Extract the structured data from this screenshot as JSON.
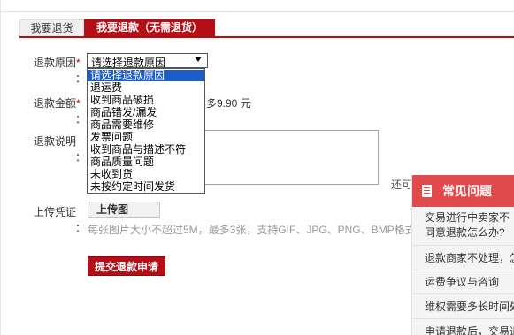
{
  "tabs": [
    {
      "label": "我要退货"
    },
    {
      "label": "我要退款（无需退货）"
    }
  ],
  "form": {
    "reason": {
      "label": "退款原因",
      "required_mark": "*",
      "colon": "：",
      "selected": "请选择退款原因",
      "options": [
        "请选择退款原因",
        "退运费",
        "收到商品破损",
        "商品错发/漏发",
        "商品需要维修",
        "发票问题",
        "收到商品与描述不符",
        "商品质量问题",
        "未收到货",
        "未按约定时间发货"
      ]
    },
    "amount": {
      "label": "退款金额",
      "required_mark": "*",
      "colon": "：",
      "tail": "多9.90 元"
    },
    "description": {
      "label": "退款说明",
      "colon": "：",
      "remaining": "还可"
    },
    "upload": {
      "label": "上传凭证",
      "colon": "：",
      "button": "上传图",
      "hint": "每张图片大小不超过5M，最多3张，支持GIF、JPG、PNG、BMP格式"
    },
    "submit": "提交退款申请"
  },
  "faq": {
    "title": "常见问题",
    "items": [
      "交易进行中卖家不同意退款怎么办?",
      "退款商家不处理，怎么办",
      "运费争议与咨询",
      "维权需要多长时间处理",
      "申请退款后，交易退款"
    ]
  },
  "colors": {
    "brand_red": "#b50e16",
    "faq_red": "#e14a4a",
    "option_highlight": "#1e5cc8"
  }
}
